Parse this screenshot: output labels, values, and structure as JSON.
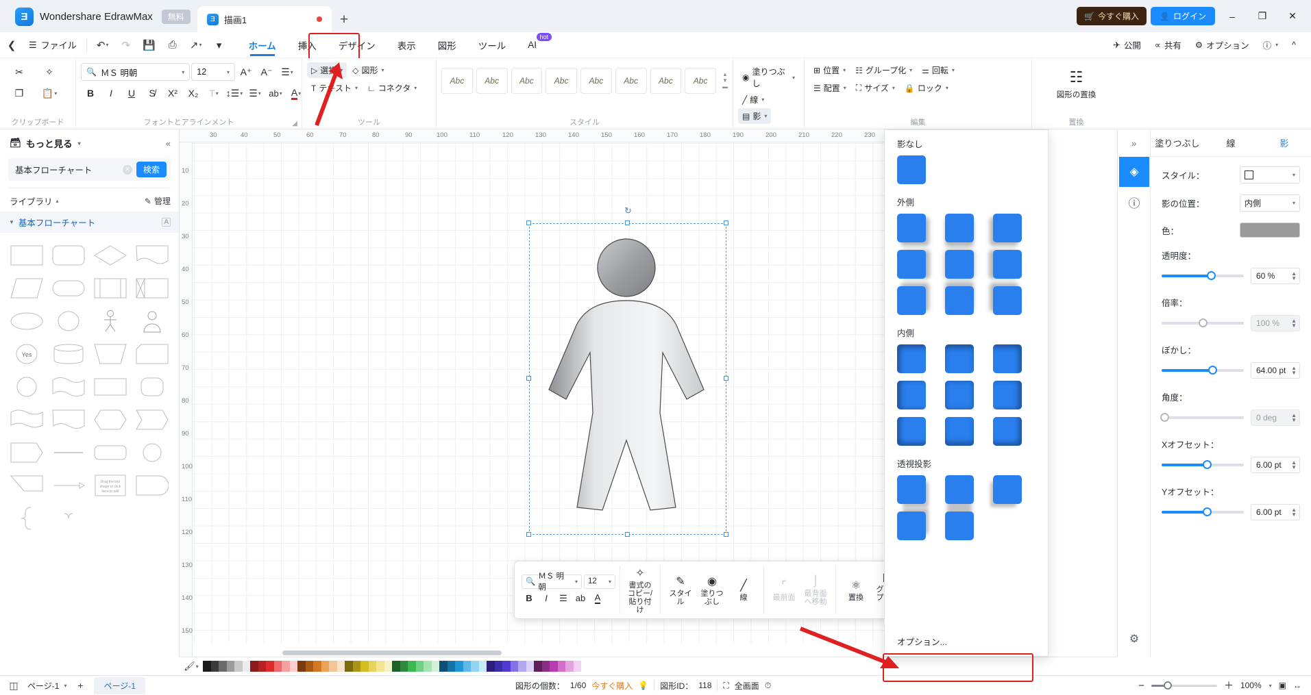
{
  "titlebar": {
    "brand": "Wondershare EdrawMax",
    "free_badge": "無料",
    "doc_tab": "描画1",
    "new_tab_icon": "plus-icon",
    "buy_label": "今すぐ購入",
    "login_label": "ログイン",
    "minimize": "—",
    "maximize": "❐",
    "close": "✕"
  },
  "menurow": {
    "back_icon": "back-chevron-icon",
    "file_label": "ファイル",
    "quick_access": [
      "undo-icon",
      "redo-icon",
      "save-icon",
      "print-icon",
      "export-icon",
      "more-chevron-icon"
    ],
    "tabs": [
      {
        "label": "ホーム",
        "active": true
      },
      {
        "label": "挿入",
        "active": false
      },
      {
        "label": "デザイン",
        "active": false
      },
      {
        "label": "表示",
        "active": false
      },
      {
        "label": "図形",
        "active": false
      },
      {
        "label": "ツール",
        "active": false
      },
      {
        "label": "AI",
        "active": false,
        "badge": "hot"
      }
    ],
    "right": [
      {
        "label": "公開",
        "icon": "publish-icon"
      },
      {
        "label": "共有",
        "icon": "share-icon"
      },
      {
        "label": "オプション",
        "icon": "gear-icon"
      },
      {
        "label": "",
        "icon": "help-icon"
      },
      {
        "label": "",
        "icon": "collapse-ribbon-icon"
      }
    ]
  },
  "ribbon": {
    "groups": [
      {
        "name": "clipboard",
        "label": "クリップボード"
      },
      {
        "name": "font_align",
        "label": "フォントとアラインメント"
      },
      {
        "name": "tools",
        "label": "ツール"
      },
      {
        "name": "styles",
        "label": "スタイル"
      },
      {
        "name": "edit",
        "label": "編集"
      },
      {
        "name": "replace",
        "label": "置換"
      }
    ],
    "font_name": "ＭＳ 明朝",
    "font_size": "12",
    "grow_font": "A⁺",
    "shrink_font": "A⁻",
    "tools": [
      {
        "label": "選択",
        "icon": "cursor-icon"
      },
      {
        "label": "テキスト",
        "icon": "text-tool-icon"
      },
      {
        "label": "図形",
        "icon": "shape-tool-icon"
      },
      {
        "label": "コネクタ",
        "icon": "connector-tool-icon"
      }
    ],
    "style_swatches": [
      "Abc",
      "Abc",
      "Abc",
      "Abc",
      "Abc",
      "Abc",
      "Abc",
      "Abc"
    ],
    "fill_label": "塗りつぶし",
    "line_label": "線",
    "shadow_label": "影",
    "position_label": "位置",
    "align_label": "配置",
    "group_label": "グループ化",
    "size_label": "サイズ",
    "rotate_label": "回転",
    "lock_label": "ロック",
    "replace_label": "図形の置換"
  },
  "leftpanel": {
    "more_label": "もっと見る",
    "search_value": "基本フローチャート",
    "search_button": "検索",
    "library_label": "ライブラリ",
    "manage_label": "管理",
    "category_label": "基本フローチャート",
    "collapse_icon": "collapse-panel-icon"
  },
  "canvas": {
    "ruler_h": [
      "30",
      "40",
      "50",
      "60",
      "70",
      "80",
      "90",
      "100",
      "110",
      "120",
      "130",
      "140",
      "150",
      "160",
      "170",
      "180",
      "190",
      "200",
      "210",
      "220",
      "230"
    ],
    "ruler_v": [
      "10",
      "20",
      "30",
      "40",
      "50",
      "60",
      "70",
      "80",
      "90",
      "100",
      "110",
      "120",
      "130",
      "140",
      "150"
    ],
    "selected_shape": "person-figure"
  },
  "floatbar": {
    "font_name": "ＭＳ 明朝",
    "font_size": "12",
    "bold": "B",
    "italic": "I",
    "align": "align-icon",
    "ab": "ab",
    "font_color": "A",
    "items": [
      {
        "label": "書式のコピー/貼り付け",
        "icon": "format-painter-icon",
        "disabled": false
      },
      {
        "label": "スタイル",
        "icon": "style-icon",
        "disabled": false
      },
      {
        "label": "塗りつぶし",
        "icon": "fill-icon",
        "disabled": false
      },
      {
        "label": "線",
        "icon": "line-icon",
        "disabled": false
      },
      {
        "label": "最前面",
        "icon": "bring-front-icon",
        "disabled": true
      },
      {
        "label": "最背面へ移動",
        "icon": "send-back-icon",
        "disabled": true
      },
      {
        "label": "置換",
        "icon": "replace-icon",
        "disabled": false
      },
      {
        "label": "グループ化解除",
        "icon": "ungroup-icon",
        "disabled": false
      }
    ],
    "pin_icon": "pin-icon"
  },
  "shadow_menu": {
    "sections": [
      {
        "title": "影なし",
        "count": 1
      },
      {
        "title": "外側",
        "count": 9
      },
      {
        "title": "内側",
        "count": 9
      },
      {
        "title": "透視投影",
        "count": 5
      }
    ],
    "options_label": "オプション..."
  },
  "rightpanel": {
    "expand_icon": "expand-icon",
    "tabs": [
      {
        "label": "塗りつぶし",
        "active": false
      },
      {
        "label": "線",
        "active": false
      },
      {
        "label": "影",
        "active": true
      }
    ],
    "tools": [
      {
        "icon": "fill-bucket-icon",
        "active": true
      },
      {
        "icon": "help-circle-icon",
        "active": false
      }
    ],
    "gear_icon": "settings-gear-icon",
    "fields": [
      {
        "name": "style",
        "label": "スタイル：",
        "type": "select",
        "value": "square-swatch"
      },
      {
        "name": "shadow_position",
        "label": "影の位置：",
        "type": "select",
        "value": "内側"
      },
      {
        "name": "color",
        "label": "色：",
        "type": "color",
        "value": "#9a9a9a"
      },
      {
        "name": "opacity",
        "label": "透明度：",
        "type": "slider",
        "value": "60 %",
        "percent": 60,
        "enabled": true
      },
      {
        "name": "magnification",
        "label": "倍率：",
        "type": "slider",
        "value": "100 %",
        "percent": 50,
        "enabled": false
      },
      {
        "name": "blur",
        "label": "ぼかし：",
        "type": "slider",
        "value": "64.00 pt",
        "percent": 62,
        "enabled": true
      },
      {
        "name": "angle",
        "label": "角度：",
        "type": "slider",
        "value": "0 deg",
        "percent": 0,
        "enabled": false
      },
      {
        "name": "x_offset",
        "label": "Xオフセット：",
        "type": "slider",
        "value": "6.00 pt",
        "percent": 55,
        "enabled": true
      },
      {
        "name": "y_offset",
        "label": "Yオフセット：",
        "type": "slider",
        "value": "6.00 pt",
        "percent": 55,
        "enabled": true
      }
    ]
  },
  "statusbar": {
    "layout_icon": "layout-icon",
    "page_name": "ページ-1",
    "add_page_icon": "add-page-icon",
    "page_tab": "ページ-1",
    "shape_count_label": "図形の個数：",
    "shape_count": "1/60",
    "buy_now": "今すぐ購入",
    "shape_id_label": "図形ID：",
    "shape_id": "118",
    "fullscreen_label": "全画面",
    "zoom_out": "−",
    "zoom_in": "＋",
    "zoom_level": "100%",
    "fit_page_icon": "fit-page-icon",
    "fit_width_icon": "fit-width-icon"
  },
  "palette": {
    "eyedropper_icon": "eyedropper-icon",
    "colors": [
      "#1b1b1b",
      "#3a3a3a",
      "#6b6b6b",
      "#9b9b9b",
      "#c9c9c9",
      "#ededed",
      "#8b1a1a",
      "#b62222",
      "#e02b2b",
      "#ef6a6a",
      "#f6a0a0",
      "#fbcfcf",
      "#7a3a0d",
      "#a85a16",
      "#d4791f",
      "#e8a45c",
      "#f2c694",
      "#f8e2c9",
      "#7a6a0d",
      "#a89516",
      "#d4bd1f",
      "#e8d45c",
      "#f2e694",
      "#f8f2c9",
      "#1f5f2a",
      "#2d8a3c",
      "#3cb853",
      "#6fd183",
      "#a3e3b0",
      "#d2f1d8",
      "#0d4f7a",
      "#1673a8",
      "#1f97d4",
      "#5cb9e8",
      "#94d4f2",
      "#c9e9f8",
      "#2a1f7a",
      "#3c2da8",
      "#5339d4",
      "#8571e8",
      "#b3a6f2",
      "#dad3f8",
      "#5f1f5a",
      "#8a2d85",
      "#b83cb0",
      "#d16fca",
      "#e3a3df",
      "#f1d2ef"
    ]
  }
}
